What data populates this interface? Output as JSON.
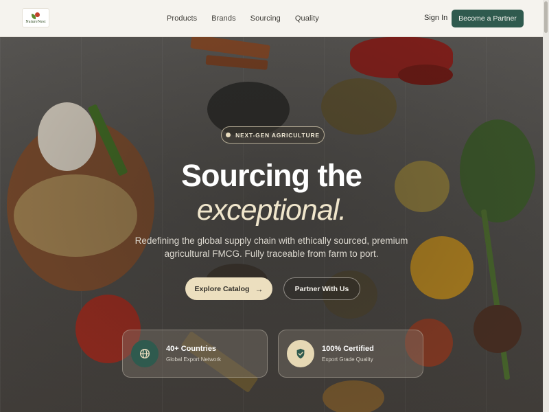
{
  "header": {
    "logo_text": "NatureNest",
    "nav": [
      "Products",
      "Brands",
      "Sourcing",
      "Quality"
    ],
    "sign_in": "Sign In",
    "cta": "Become a Partner"
  },
  "hero": {
    "badge": "NEXT-GEN AGRICULTURE",
    "title_line1": "Sourcing the",
    "title_line2": "exceptional.",
    "subtitle": "Redefining the global supply chain with ethically sourced, premium agricultural FMCG. Fully traceable from farm to port.",
    "primary_button": "Explore Catalog",
    "primary_button_icon": "arrow-right-icon",
    "secondary_button": "Partner With Us"
  },
  "stats": [
    {
      "title": "40+ Countries",
      "subtitle": "Global Export Network",
      "icon": "globe-icon",
      "icon_bg": "#2f5a4e"
    },
    {
      "title": "100% Certified",
      "subtitle": "Export Grade Quality",
      "icon": "shield-check-icon",
      "icon_bg": "#e6d8b4"
    }
  ],
  "colors": {
    "brand_green": "#2f5a4e",
    "accent_cream": "#ecdfbf",
    "header_bg": "#f5f3ee"
  }
}
